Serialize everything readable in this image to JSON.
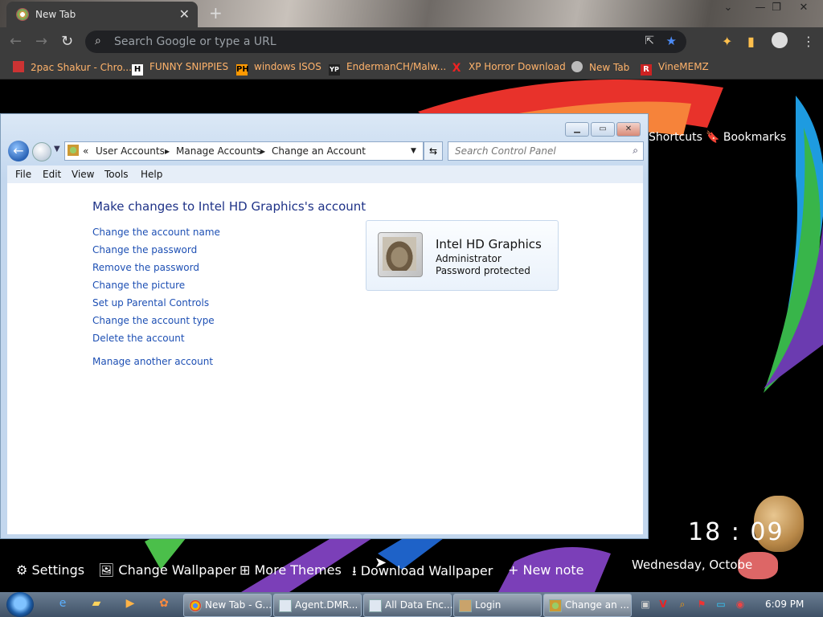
{
  "browser": {
    "tab_title": "New Tab",
    "new_tab_symbol": "+",
    "omnibox_placeholder": "Search Google or type a URL",
    "bookmarks": [
      {
        "label": "2pac Shakur - Chro...",
        "icon": "bookmark-favicon"
      },
      {
        "label": "FUNNY SNIPPIES",
        "icon": "H"
      },
      {
        "label": "windows ISOS",
        "icon": "PH"
      },
      {
        "label": "EndermanCH/Malw...",
        "icon": "YP"
      },
      {
        "label": "XP Horror Download",
        "icon": "X"
      },
      {
        "label": "New Tab",
        "icon": "globe"
      },
      {
        "label": "VineMEMZ",
        "icon": "R"
      }
    ]
  },
  "ntp": {
    "shortcuts": "Shortcuts",
    "bookmarks": "Bookmarks",
    "bottom": {
      "settings": "Settings",
      "change_wallpaper": "Change Wallpaper",
      "more_themes": "More Themes",
      "download_wallpaper": "Download Wallpaper",
      "new_note": "+ New note"
    },
    "clock": "18 : 09",
    "date": "Wednesday, Octobe"
  },
  "control_panel": {
    "breadcrumb": [
      "User Accounts",
      "Manage Accounts",
      "Change an Account"
    ],
    "breadcrumb_prefix": "«",
    "search_placeholder": "Search Control Panel",
    "menus": [
      "File",
      "Edit",
      "View",
      "Tools",
      "Help"
    ],
    "heading": "Make changes to Intel HD Graphics's account",
    "tasks": [
      "Change the account name",
      "Change the password",
      "Remove the password",
      "Change the picture",
      "Set up Parental Controls",
      "Change the account type",
      "Delete the account"
    ],
    "other_task": "Manage another account",
    "account": {
      "name": "Intel HD Graphics",
      "type": "Administrator",
      "status": "Password protected"
    }
  },
  "taskbar": {
    "buttons": [
      "New Tab - G...",
      "Agent.DMR...",
      "All Data Enc...",
      "Login",
      "Change an ..."
    ],
    "time": "6:09 PM"
  }
}
